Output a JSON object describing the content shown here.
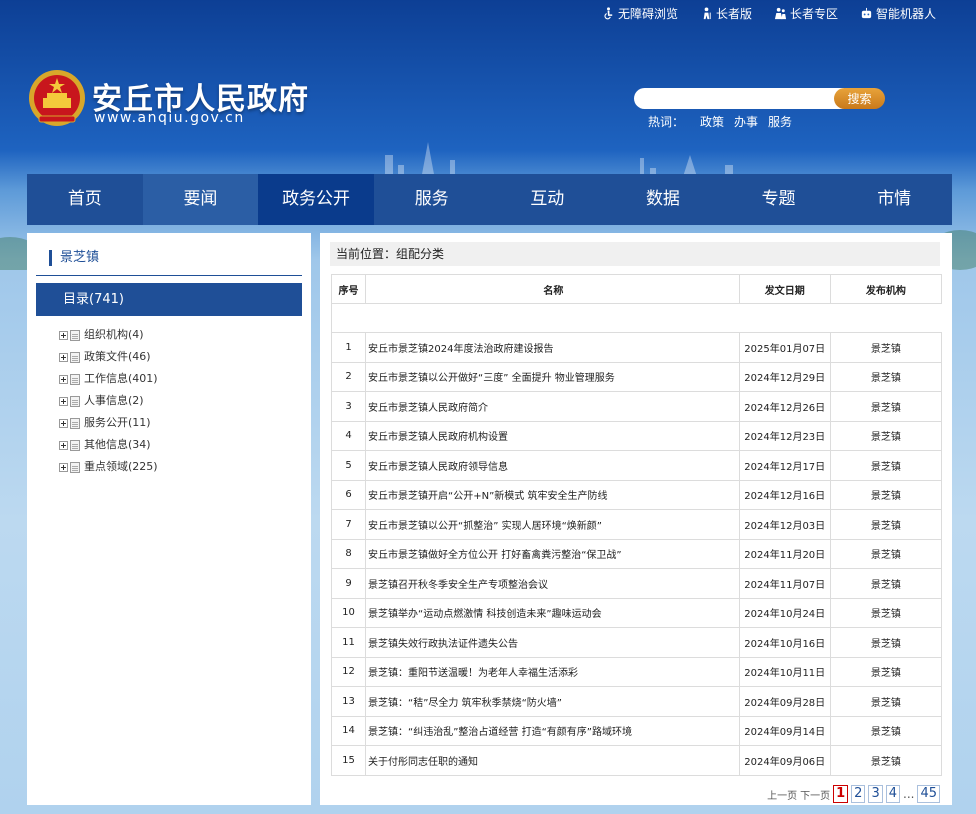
{
  "toplinks": [
    {
      "label": "无障碍浏览",
      "icon": "wheelchair-icon"
    },
    {
      "label": "长者版",
      "icon": "elder-icon"
    },
    {
      "label": "长者专区",
      "icon": "elder-zone-icon"
    },
    {
      "label": "智能机器人",
      "icon": "robot-icon"
    }
  ],
  "header": {
    "title": "安丘市人民政府",
    "url": "www.anqiu.gov.cn",
    "search_placeholder": "",
    "search_button": "搜索",
    "hot_label": "热词：",
    "hot_words": [
      "政策",
      "办事",
      "服务"
    ]
  },
  "nav": [
    {
      "label": "首页"
    },
    {
      "label": "要闻"
    },
    {
      "label": "政务公开",
      "active": true
    },
    {
      "label": "服务"
    },
    {
      "label": "互动"
    },
    {
      "label": "数据"
    },
    {
      "label": "专题"
    },
    {
      "label": "市情"
    }
  ],
  "sidebar": {
    "title": "景芝镇",
    "dir_label": "目录(741)",
    "items": [
      {
        "label": "组织机构(4)"
      },
      {
        "label": "政策文件(46)"
      },
      {
        "label": "工作信息(401)"
      },
      {
        "label": "人事信息(2)"
      },
      {
        "label": "服务公开(11)"
      },
      {
        "label": "其他信息(34)"
      },
      {
        "label": "重点领域(225)"
      }
    ]
  },
  "breadcrumb": "当前位置：组配分类",
  "table": {
    "headers": {
      "no": "序号",
      "name": "名称",
      "date": "发文日期",
      "org": "发布机构"
    },
    "rows": [
      {
        "no": "1",
        "name": "安丘市景芝镇2024年度法治政府建设报告",
        "date": "2025年01月07日",
        "org": "景芝镇"
      },
      {
        "no": "2",
        "name": "安丘市景芝镇以公开做好“三度” 全面提升 物业管理服务",
        "date": "2024年12月29日",
        "org": "景芝镇"
      },
      {
        "no": "3",
        "name": "安丘市景芝镇人民政府简介",
        "date": "2024年12月26日",
        "org": "景芝镇"
      },
      {
        "no": "4",
        "name": "安丘市景芝镇人民政府机构设置",
        "date": "2024年12月23日",
        "org": "景芝镇"
      },
      {
        "no": "5",
        "name": "安丘市景芝镇人民政府领导信息",
        "date": "2024年12月17日",
        "org": "景芝镇"
      },
      {
        "no": "6",
        "name": "安丘市景芝镇开启“公开+N”新模式 筑牢安全生产防线",
        "date": "2024年12月16日",
        "org": "景芝镇"
      },
      {
        "no": "7",
        "name": "安丘市景芝镇以公开“抓整治” 实现人居环境“焕新颜”",
        "date": "2024年12月03日",
        "org": "景芝镇"
      },
      {
        "no": "8",
        "name": "安丘市景芝镇做好全方位公开 打好畜禽粪污整治“保卫战”",
        "date": "2024年11月20日",
        "org": "景芝镇"
      },
      {
        "no": "9",
        "name": "景芝镇召开秋冬季安全生产专项整治会议",
        "date": "2024年11月07日",
        "org": "景芝镇"
      },
      {
        "no": "10",
        "name": "景芝镇举办“运动点燃激情 科技创造未来”趣味运动会",
        "date": "2024年10月24日",
        "org": "景芝镇"
      },
      {
        "no": "11",
        "name": "景芝镇失效行政执法证件遗失公告",
        "date": "2024年10月16日",
        "org": "景芝镇"
      },
      {
        "no": "12",
        "name": "景芝镇：重阳节送温暖！为老年人幸福生活添彩",
        "date": "2024年10月11日",
        "org": "景芝镇"
      },
      {
        "no": "13",
        "name": "景芝镇：“秸”尽全力 筑牢秋季禁烧“防火墙”",
        "date": "2024年09月28日",
        "org": "景芝镇"
      },
      {
        "no": "14",
        "name": "景芝镇：“纠违治乱”整治占道经营 打造“有颜有序”路域环境",
        "date": "2024年09月14日",
        "org": "景芝镇"
      },
      {
        "no": "15",
        "name": "关于付彤同志任职的通知",
        "date": "2024年09月06日",
        "org": "景芝镇"
      }
    ]
  },
  "pager": {
    "prev": "上一页",
    "next": "下一页",
    "pages": [
      "1",
      "2",
      "3",
      "4"
    ],
    "current": "1",
    "dots": "...",
    "last": "45"
  }
}
